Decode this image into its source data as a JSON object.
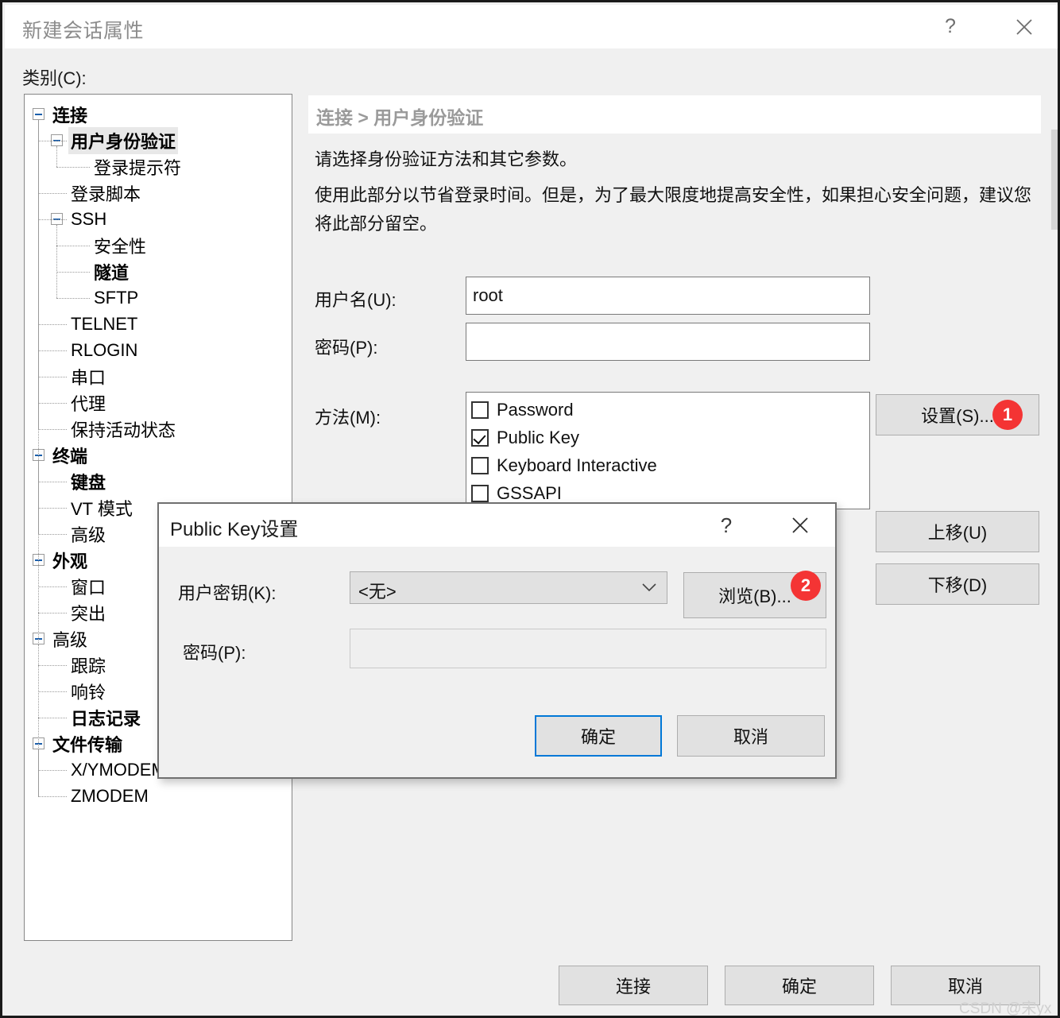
{
  "window": {
    "title": "新建会话属性",
    "help_icon": "?",
    "close_icon": "close-icon"
  },
  "category_label": "类别(C):",
  "tree": {
    "nodes": [
      {
        "label": "连接",
        "depth": 0,
        "bold": true,
        "selected": false,
        "expandable": true
      },
      {
        "label": "用户身份验证",
        "depth": 1,
        "bold": true,
        "selected": true,
        "expandable": true
      },
      {
        "label": "登录提示符",
        "depth": 2,
        "bold": false,
        "selected": false,
        "expandable": false
      },
      {
        "label": "登录脚本",
        "depth": 1,
        "bold": false,
        "selected": false,
        "expandable": false
      },
      {
        "label": "SSH",
        "depth": 1,
        "bold": false,
        "selected": false,
        "expandable": true
      },
      {
        "label": "安全性",
        "depth": 2,
        "bold": false,
        "selected": false,
        "expandable": false
      },
      {
        "label": "隧道",
        "depth": 2,
        "bold": true,
        "selected": false,
        "expandable": false
      },
      {
        "label": "SFTP",
        "depth": 2,
        "bold": false,
        "selected": false,
        "expandable": false
      },
      {
        "label": "TELNET",
        "depth": 1,
        "bold": false,
        "selected": false,
        "expandable": false
      },
      {
        "label": "RLOGIN",
        "depth": 1,
        "bold": false,
        "selected": false,
        "expandable": false
      },
      {
        "label": "串口",
        "depth": 1,
        "bold": false,
        "selected": false,
        "expandable": false
      },
      {
        "label": "代理",
        "depth": 1,
        "bold": false,
        "selected": false,
        "expandable": false
      },
      {
        "label": "保持活动状态",
        "depth": 1,
        "bold": false,
        "selected": false,
        "expandable": false
      },
      {
        "label": "终端",
        "depth": 0,
        "bold": true,
        "selected": false,
        "expandable": true
      },
      {
        "label": "键盘",
        "depth": 1,
        "bold": true,
        "selected": false,
        "expandable": false
      },
      {
        "label": "VT 模式",
        "depth": 1,
        "bold": false,
        "selected": false,
        "expandable": false
      },
      {
        "label": "高级",
        "depth": 1,
        "bold": false,
        "selected": false,
        "expandable": false
      },
      {
        "label": "外观",
        "depth": 0,
        "bold": true,
        "selected": false,
        "expandable": true
      },
      {
        "label": "窗口",
        "depth": 1,
        "bold": false,
        "selected": false,
        "expandable": false
      },
      {
        "label": "突出",
        "depth": 1,
        "bold": false,
        "selected": false,
        "expandable": false
      },
      {
        "label": "高级",
        "depth": 0,
        "bold": false,
        "selected": false,
        "expandable": true
      },
      {
        "label": "跟踪",
        "depth": 1,
        "bold": false,
        "selected": false,
        "expandable": false
      },
      {
        "label": "响铃",
        "depth": 1,
        "bold": false,
        "selected": false,
        "expandable": false
      },
      {
        "label": "日志记录",
        "depth": 1,
        "bold": true,
        "selected": false,
        "expandable": false
      },
      {
        "label": "文件传输",
        "depth": 0,
        "bold": true,
        "selected": false,
        "expandable": true
      },
      {
        "label": "X/YMODEM",
        "depth": 1,
        "bold": false,
        "selected": false,
        "expandable": false
      },
      {
        "label": "ZMODEM",
        "depth": 1,
        "bold": false,
        "selected": false,
        "expandable": false
      }
    ]
  },
  "main": {
    "breadcrumb": "连接 > 用户身份验证",
    "description_line1": "请选择身份验证方法和其它参数。",
    "description_line2": "使用此部分以节省登录时间。但是，为了最大限度地提高安全性，如果担心安全问题，建议您将此部分留空。",
    "username_label": "用户名(U):",
    "username_value": "root",
    "password_label": "密码(P):",
    "password_value": "",
    "methods_label": "方法(M):",
    "methods": [
      {
        "label": "Password",
        "checked": false
      },
      {
        "label": "Public Key",
        "checked": true
      },
      {
        "label": "Keyboard Interactive",
        "checked": false
      },
      {
        "label": "GSSAPI",
        "checked": false
      }
    ],
    "settings_button": "设置(S)...",
    "settings_badge": "1",
    "move_up_button": "上移(U)",
    "move_down_button": "下移(D)"
  },
  "footer": {
    "connect_button": "连接",
    "ok_button": "确定",
    "cancel_button": "取消"
  },
  "modal": {
    "title": "Public Key设置",
    "help_icon": "?",
    "close_icon": "close-icon",
    "user_key_label": "用户密钥(K):",
    "user_key_value": "<无>",
    "browse_button": "浏览(B)...",
    "browse_badge": "2",
    "password_label": "密码(P):",
    "password_value": "",
    "ok_button": "确定",
    "cancel_button": "取消"
  },
  "watermark": "CSDN @宋yx",
  "colors": {
    "accent": "#0078d7",
    "badge": "#f43434",
    "window_bg": "#f0f0f0",
    "panel_bg": "#ffffff"
  }
}
